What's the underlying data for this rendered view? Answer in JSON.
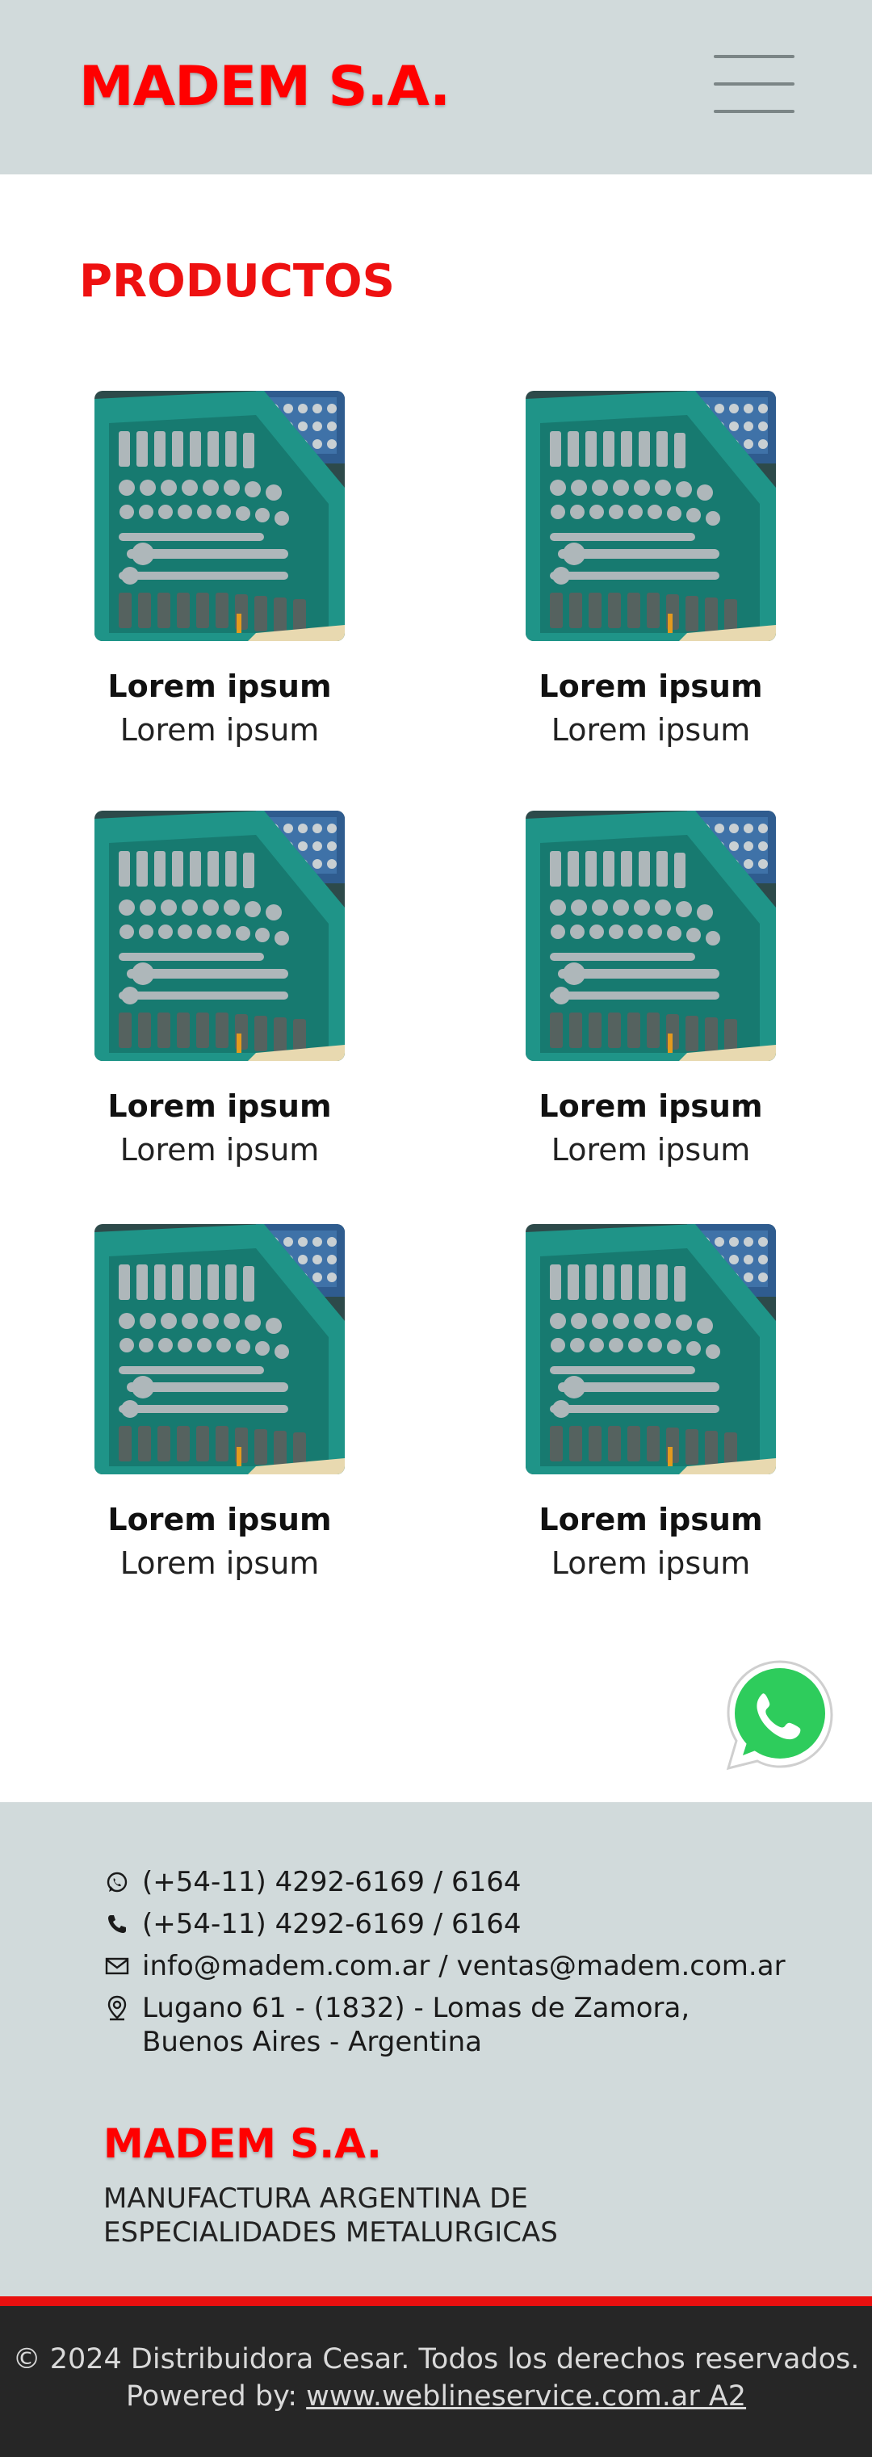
{
  "header": {
    "brand": "MADEM S.A.",
    "menu_icon": "hamburger-menu-icon"
  },
  "section": {
    "title": "PRODUCTOS"
  },
  "products": [
    {
      "name": "Lorem ipsum",
      "subtitle": "Lorem ipsum"
    },
    {
      "name": "Lorem ipsum",
      "subtitle": "Lorem ipsum"
    },
    {
      "name": "Lorem ipsum",
      "subtitle": "Lorem ipsum"
    },
    {
      "name": "Lorem ipsum",
      "subtitle": "Lorem ipsum"
    },
    {
      "name": "Lorem ipsum",
      "subtitle": "Lorem ipsum"
    },
    {
      "name": "Lorem ipsum",
      "subtitle": "Lorem ipsum"
    }
  ],
  "contact": {
    "whatsapp": "(+54-11) 4292-6169 / 6164",
    "phone": "(+54-11) 4292-6169 / 6164",
    "email": "info@madem.com.ar / ventas@madem.com.ar",
    "address_line1": "Lugano 61 - (1832) - Lomas de Zamora,",
    "address_line2": "Buenos Aires - Argentina"
  },
  "footer": {
    "brand": "MADEM S.A.",
    "tagline_line1": "MANUFACTURA ARGENTINA DE",
    "tagline_line2": "ESPECIALIDADES METALURGICAS",
    "copyright": "© 2024 Distribuidora Cesar. Todos los derechos reservados.",
    "powered_prefix": "Powered by: ",
    "powered_link": "www.weblineservice.com.ar A2"
  },
  "colors": {
    "brand_red": "#ff0000",
    "header_bg": "#d1dadb",
    "footer_dark": "#262626",
    "toolbox_teal": "#1f9488"
  }
}
